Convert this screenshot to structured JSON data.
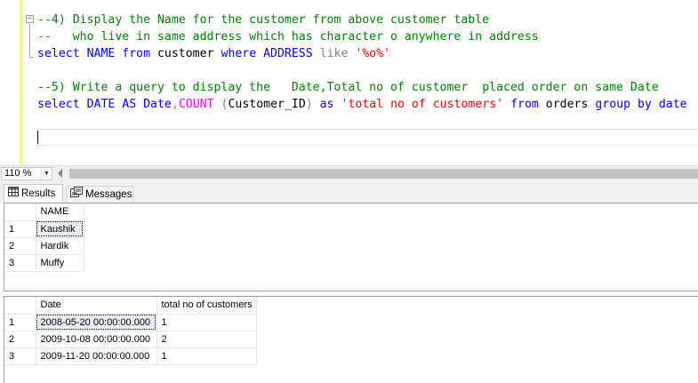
{
  "editor": {
    "lines": [
      [
        {
          "t": "--4) Display the Name for the customer from above customer table",
          "c": "cm"
        }
      ],
      [
        {
          "t": "--   who live in same address which has character o anywhere in address",
          "c": "cm"
        }
      ],
      [
        {
          "t": "select",
          "c": "kw"
        },
        {
          "t": " NAME ",
          "c": "kw"
        },
        {
          "t": "from",
          "c": "kw"
        },
        {
          "t": " customer ",
          "c": "id"
        },
        {
          "t": "where",
          "c": "kw"
        },
        {
          "t": " ADDRESS ",
          "c": "kw"
        },
        {
          "t": "like",
          "c": "gr"
        },
        {
          "t": " ",
          "c": "id"
        },
        {
          "t": "'%o%'",
          "c": "str"
        }
      ],
      [
        {
          "t": "",
          "c": "id"
        }
      ],
      [
        {
          "t": "--5) Write a query to display the   Date,Total no of customer  placed order on same Date",
          "c": "cm"
        }
      ],
      [
        {
          "t": "select",
          "c": "kw"
        },
        {
          "t": " DATE ",
          "c": "kw"
        },
        {
          "t": "AS",
          "c": "kw"
        },
        {
          "t": " Date",
          "c": "kw"
        },
        {
          "t": ",",
          "c": "gr"
        },
        {
          "t": "COUNT",
          "c": "fn"
        },
        {
          "t": " ",
          "c": "id"
        },
        {
          "t": "(",
          "c": "gr"
        },
        {
          "t": "Customer_ID",
          "c": "id"
        },
        {
          "t": ")",
          "c": "gr"
        },
        {
          "t": " as ",
          "c": "kw"
        },
        {
          "t": "'total no of customers'",
          "c": "str"
        },
        {
          "t": " from",
          "c": "kw"
        },
        {
          "t": " orders ",
          "c": "id"
        },
        {
          "t": "group",
          "c": "kw"
        },
        {
          "t": " ",
          "c": "id"
        },
        {
          "t": "by",
          "c": "kw"
        },
        {
          "t": " date",
          "c": "kw"
        }
      ]
    ]
  },
  "zoom": {
    "value": "110 %"
  },
  "tabs": {
    "results_label": "Results",
    "messages_label": "Messages"
  },
  "results1": {
    "headers": [
      "NAME"
    ],
    "rows": [
      {
        "num": "1",
        "cells": [
          "Kaushik"
        ]
      },
      {
        "num": "2",
        "cells": [
          "Hardik"
        ]
      },
      {
        "num": "3",
        "cells": [
          "Muffy"
        ]
      }
    ]
  },
  "results2": {
    "headers": [
      "Date",
      "total no of customers"
    ],
    "rows": [
      {
        "num": "1",
        "cells": [
          "2008-05-20 00:00:00.000",
          "1"
        ]
      },
      {
        "num": "2",
        "cells": [
          "2009-10-08 00:00:00.000",
          "2"
        ]
      },
      {
        "num": "3",
        "cells": [
          "2009-11-20 00:00:00.000",
          "1"
        ]
      }
    ]
  }
}
